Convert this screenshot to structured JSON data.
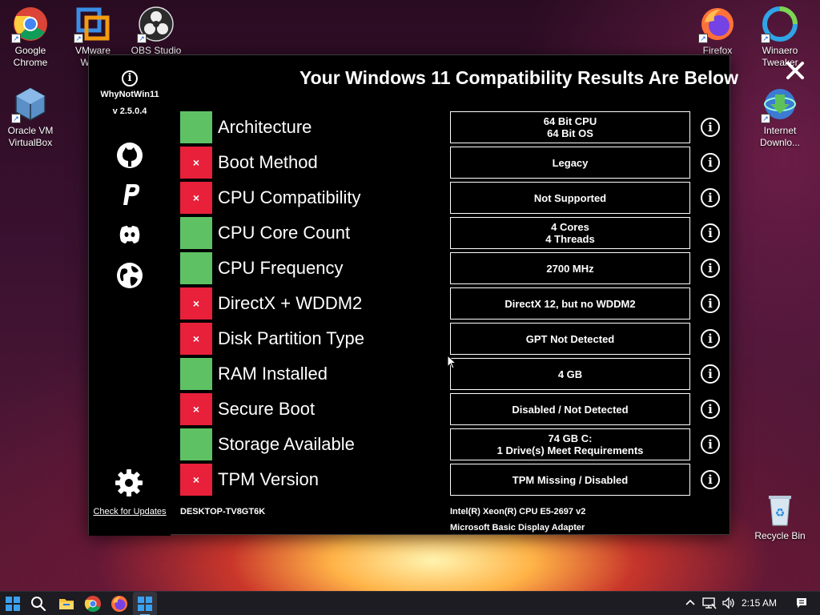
{
  "desktop": {
    "icons_left": [
      {
        "label": "Google Chrome",
        "icon": "chrome-icon"
      },
      {
        "label": "VMware Wor...",
        "icon": "vmware-icon"
      },
      {
        "label": "OBS Studio",
        "icon": "obs-icon"
      },
      {
        "label": "Oracle VM VirtualBox",
        "icon": "virtualbox-icon"
      }
    ],
    "icons_right": [
      {
        "label": "Firefox",
        "icon": "firefox-icon"
      },
      {
        "label": "Winaero Tweaker",
        "icon": "winaero-icon"
      },
      {
        "label": "Internet Downlo...",
        "icon": "idm-icon"
      },
      {
        "label": "Recycle Bin",
        "icon": "recycle-bin-icon"
      }
    ]
  },
  "app": {
    "name": "WhyNotWin11",
    "version": "v 2.5.0.4",
    "title": "Your Windows 11 Compatibility Results Are Below",
    "check_updates": "Check for Updates",
    "fail_mark": "×",
    "info_glyph": "i",
    "close_glyph": "✕",
    "rows": [
      {
        "name": "Architecture",
        "status": "pass",
        "value": [
          "64 Bit CPU",
          "64 Bit OS"
        ]
      },
      {
        "name": "Boot Method",
        "status": "fail",
        "value": [
          "Legacy"
        ]
      },
      {
        "name": "CPU Compatibility",
        "status": "fail",
        "value": [
          "Not Supported"
        ]
      },
      {
        "name": "CPU Core Count",
        "status": "pass",
        "value": [
          "4 Cores",
          "4 Threads"
        ]
      },
      {
        "name": "CPU Frequency",
        "status": "pass",
        "value": [
          "2700 MHz"
        ]
      },
      {
        "name": "DirectX + WDDM2",
        "status": "fail",
        "value": [
          "DirectX 12, but no WDDM2"
        ]
      },
      {
        "name": "Disk Partition Type",
        "status": "fail",
        "value": [
          "GPT Not Detected"
        ]
      },
      {
        "name": "RAM Installed",
        "status": "pass",
        "value": [
          "4 GB"
        ]
      },
      {
        "name": "Secure Boot",
        "status": "fail",
        "value": [
          "Disabled / Not Detected"
        ]
      },
      {
        "name": "Storage Available",
        "status": "pass",
        "value": [
          "74 GB C:",
          "1 Drive(s) Meet Requirements"
        ]
      },
      {
        "name": "TPM Version",
        "status": "fail",
        "value": [
          "TPM Missing / Disabled"
        ]
      }
    ],
    "footer": {
      "computer_name": "DESKTOP-TV8GT6K",
      "cpu": "Intel(R) Xeon(R) CPU E5-2697 v2",
      "gpu": "Microsoft Basic Display Adapter"
    },
    "colors": {
      "pass": "#5ec264",
      "fail": "#e8203a"
    }
  },
  "taskbar": {
    "clock": "2:15 AM"
  }
}
